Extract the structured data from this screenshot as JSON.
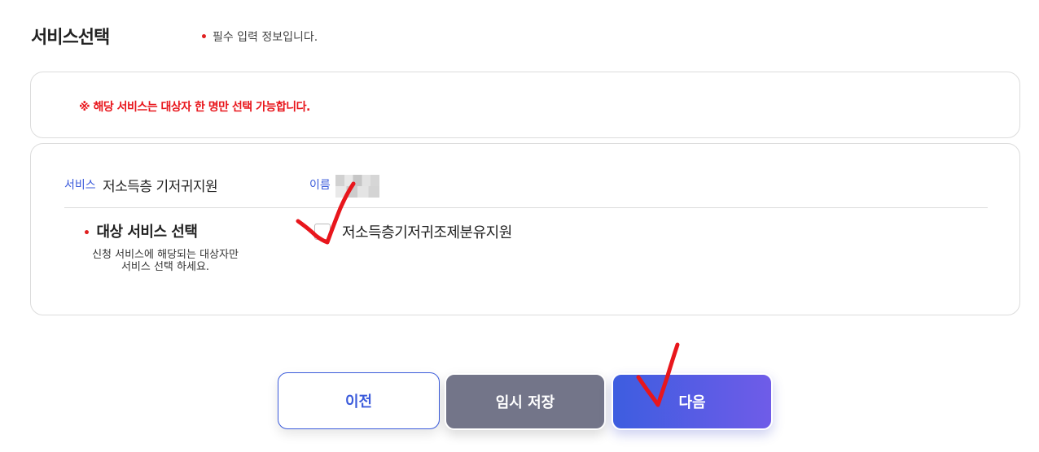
{
  "header": {
    "title": "서비스선택",
    "required_note": "필수 입력 정보입니다."
  },
  "notice": {
    "text": "※ 해당 서비스는 대상자 한 명만 선택 가능합니다."
  },
  "service": {
    "label": "서비스",
    "value": "저소득층 기저귀지원",
    "name_label": "이름",
    "target_title": "대상 서비스 선택",
    "target_desc_line1": "신청 서비스에 해당되는 대상자만",
    "target_desc_line2": "서비스 선택 하세요.",
    "option_label": "저소득층기저귀조제분유지원",
    "option_checked": false
  },
  "buttons": {
    "prev": "이전",
    "save": "임시 저장",
    "next": "다음"
  },
  "colors": {
    "accent": "#3b5bdb",
    "required": "#e02020",
    "annotation": "#e8161c",
    "save_button": "#737589"
  }
}
